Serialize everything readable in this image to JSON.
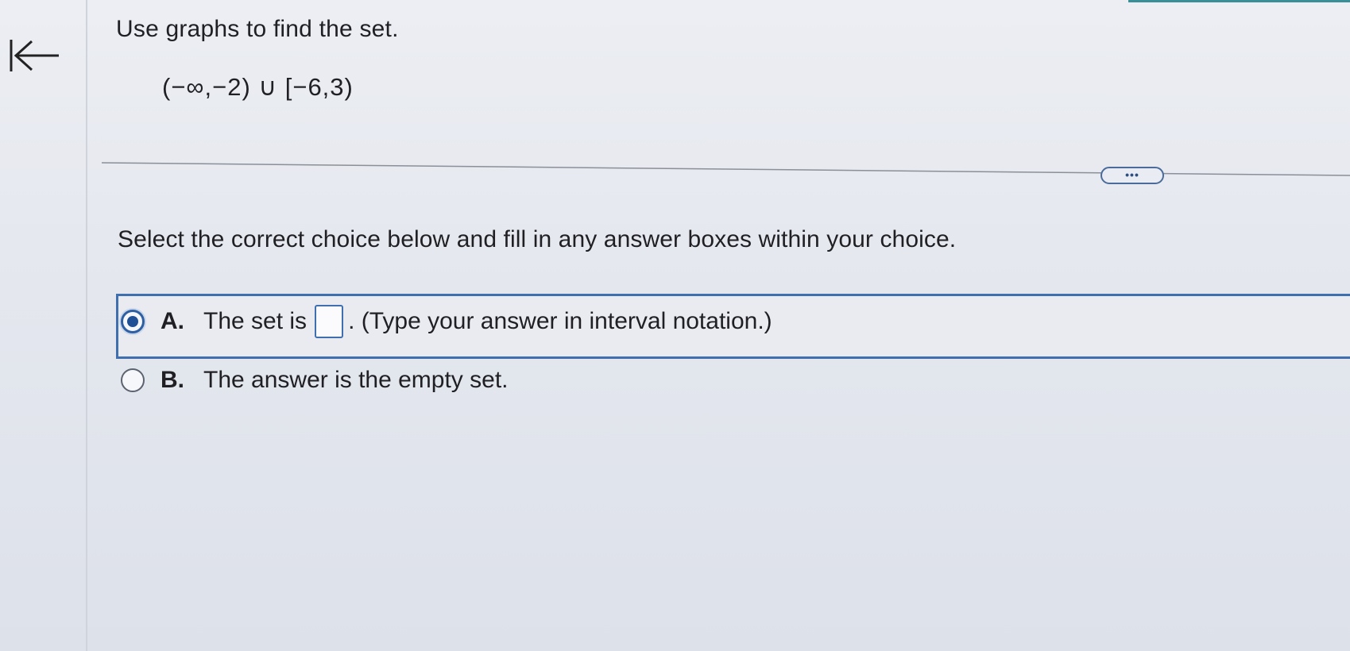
{
  "question": {
    "title": "Use graphs to find the set.",
    "expression": "(−∞,−2) ∪ [−6,3)"
  },
  "more_button": {
    "label": "•••"
  },
  "instructions": "Select the correct choice below and fill in any answer boxes within your choice.",
  "choices": [
    {
      "letter": "A.",
      "text_before": "The set is",
      "answer_value": "",
      "text_after": ". (Type your answer in interval notation.)",
      "selected": true
    },
    {
      "letter": "B.",
      "text": "The answer is the empty set.",
      "selected": false
    }
  ],
  "colors": {
    "selection_accent": "#3f6fae",
    "top_accent": "#3a8e97"
  },
  "icons": {
    "back": "collapse-left-arrow-icon",
    "radio_selected": "radio-selected-icon",
    "radio_unselected": "radio-unselected-icon"
  }
}
